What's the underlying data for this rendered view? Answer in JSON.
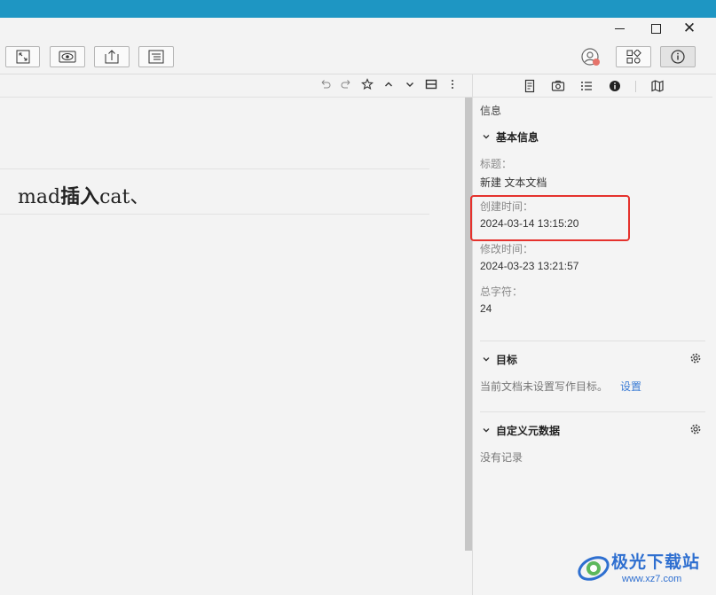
{
  "window": {
    "close_glyph": "✕"
  },
  "toolbar": {
    "buttons": [
      "expand-icon",
      "preview-eye-icon",
      "export-icon",
      "layout-icon",
      "user-status-icon",
      "widgets-icon",
      "info-icon"
    ]
  },
  "editor": {
    "text_normal_1": "mad",
    "text_bold": "插入",
    "text_normal_2": "cat、"
  },
  "panel": {
    "title": "信息",
    "basic": {
      "heading": "基本信息",
      "title_label": "标题：",
      "title_value": "新建 文本文档",
      "created_label": "创建时间：",
      "created_value": "2024-03-14 13:15:20",
      "modified_label": "修改时间：",
      "modified_value": "2024-03-23 13:21:57",
      "chars_label": "总字符：",
      "chars_value": "24"
    },
    "goal": {
      "heading": "目标",
      "text": "当前文档未设置写作目标。",
      "link": "设置"
    },
    "meta": {
      "heading": "自定义元数据",
      "text": "没有记录"
    }
  },
  "watermark": {
    "name": "极光下载站",
    "url": "www.xz7.com"
  },
  "colors": {
    "accent_bar": "#1e96c3",
    "highlight": "#e5322d",
    "link": "#3a7bd5"
  }
}
